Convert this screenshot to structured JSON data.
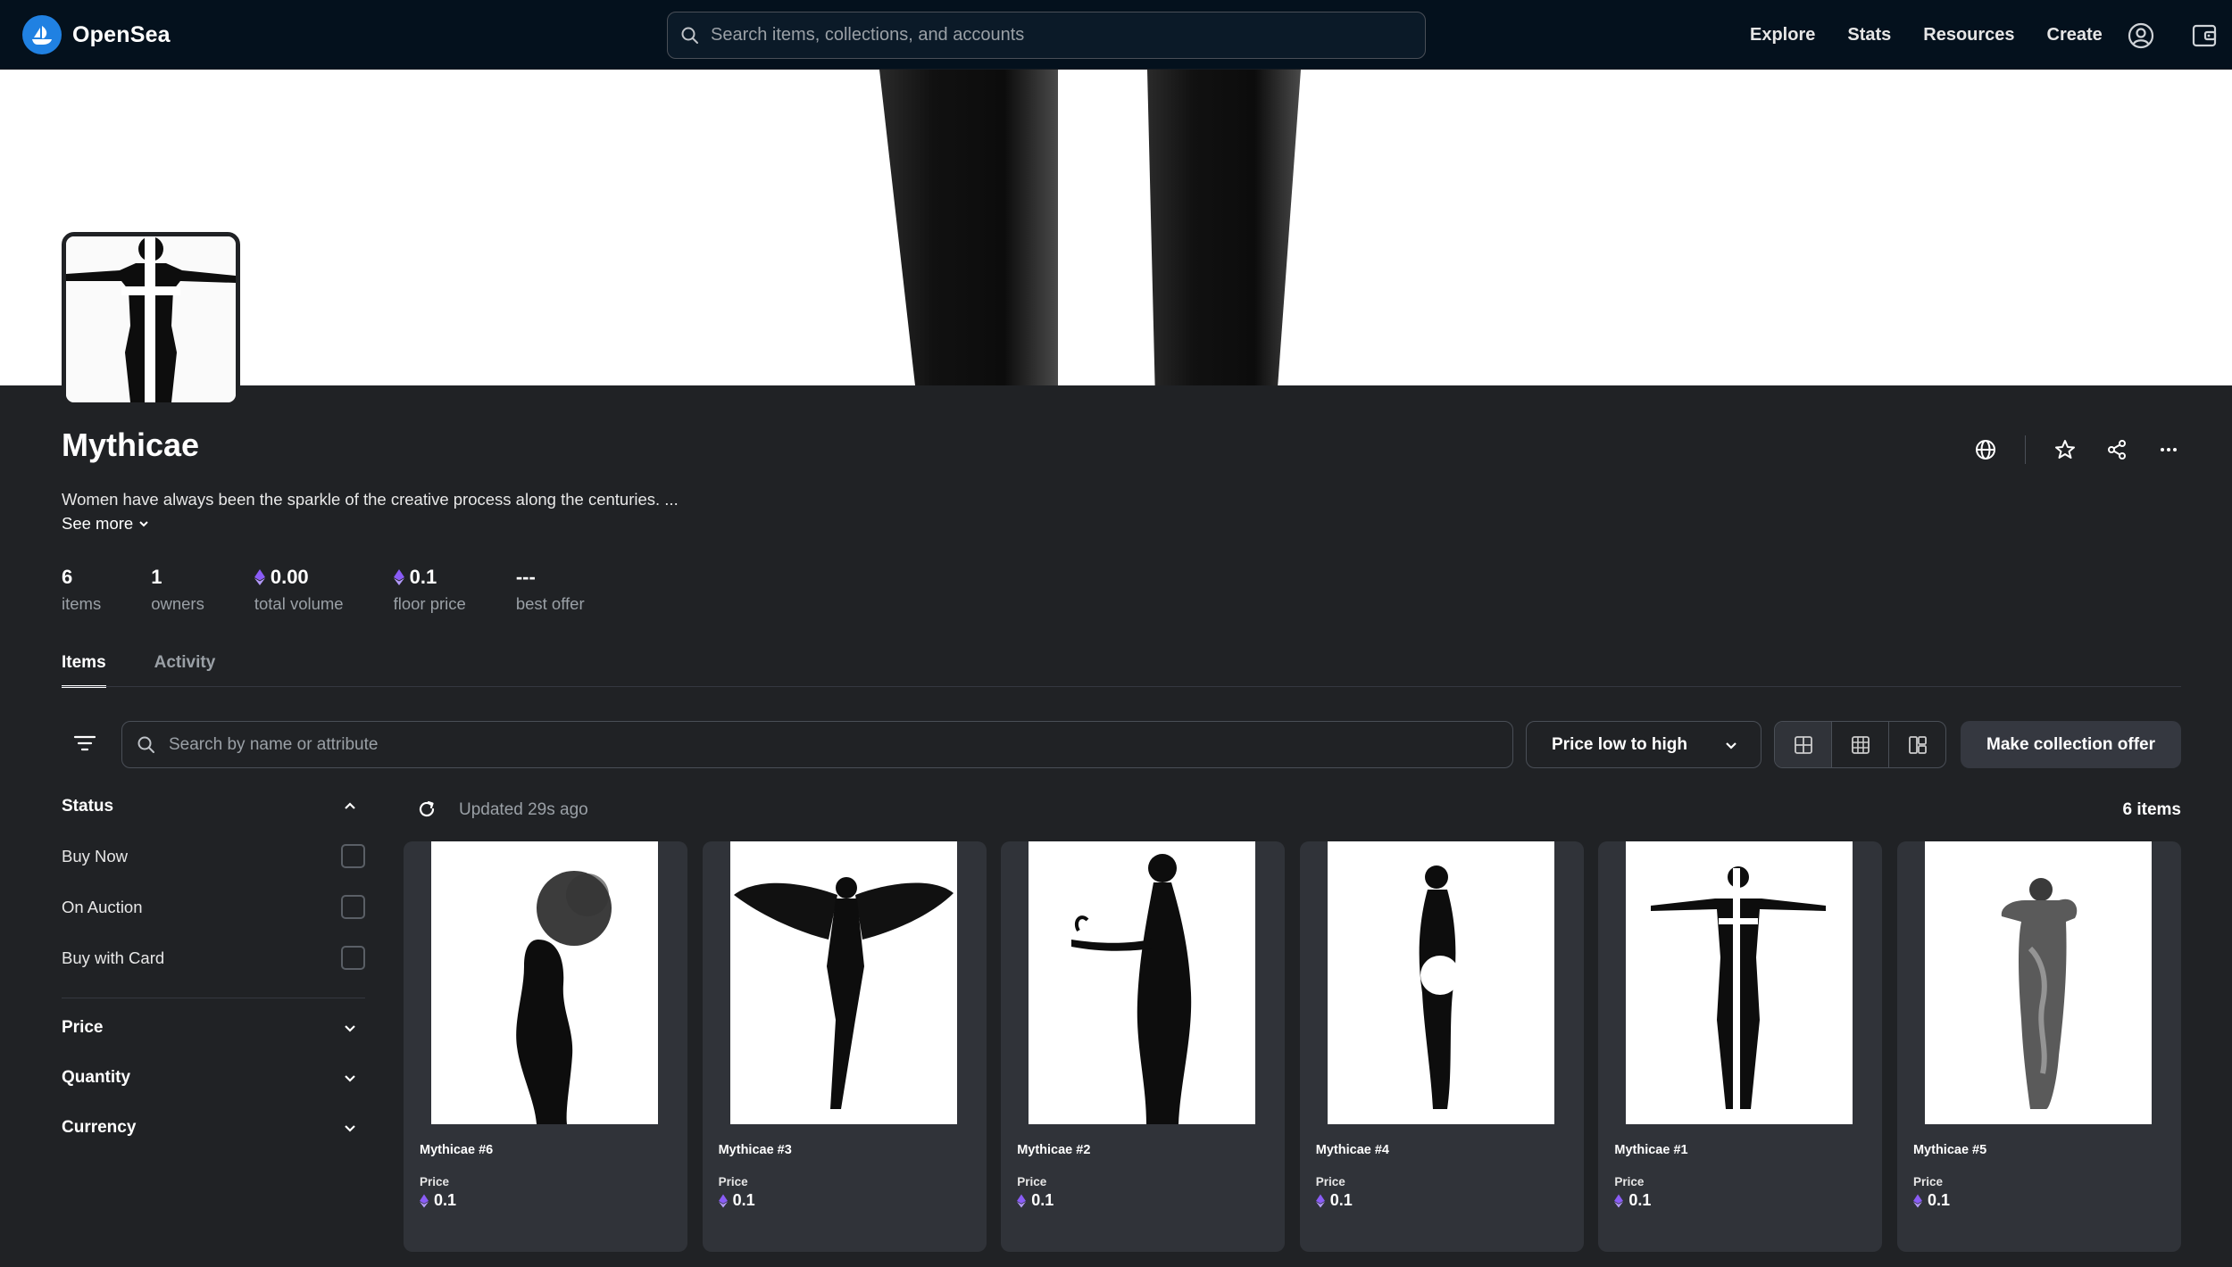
{
  "nav": {
    "brand": "OpenSea",
    "search_placeholder": "Search items, collections, and accounts",
    "links": [
      "Explore",
      "Stats",
      "Resources",
      "Create"
    ]
  },
  "collection": {
    "title": "Mythicae",
    "description": "Women have always been the sparkle of the creative process along the centuries.  ...",
    "see_more": "See more",
    "stats": [
      {
        "value": "6",
        "label": "items",
        "eth": false
      },
      {
        "value": "1",
        "label": "owners",
        "eth": false
      },
      {
        "value": "0.00",
        "label": "total volume",
        "eth": true
      },
      {
        "value": "0.1",
        "label": "floor price",
        "eth": true
      },
      {
        "value": "---",
        "label": "best offer",
        "eth": false
      }
    ]
  },
  "tabs": [
    "Items",
    "Activity"
  ],
  "toolbar": {
    "search_placeholder": "Search by name or attribute",
    "sort_label": "Price low to high",
    "offer_label": "Make collection offer"
  },
  "sidebar": {
    "status_label": "Status",
    "status_options": [
      "Buy Now",
      "On Auction",
      "Buy with Card"
    ],
    "price_label": "Price",
    "quantity_label": "Quantity",
    "currency_label": "Currency"
  },
  "results": {
    "updated": "Updated 29s ago",
    "count": "6 items",
    "price_label": "Price",
    "items": [
      {
        "name": "Mythicae #6",
        "price": "0.1"
      },
      {
        "name": "Mythicae #3",
        "price": "0.1"
      },
      {
        "name": "Mythicae #2",
        "price": "0.1"
      },
      {
        "name": "Mythicae #4",
        "price": "0.1"
      },
      {
        "name": "Mythicae #1",
        "price": "0.1"
      },
      {
        "name": "Mythicae #5",
        "price": "0.1"
      }
    ]
  },
  "colors": {
    "nav_bg": "#04111d",
    "page_bg": "#202225",
    "card_bg": "#303339",
    "eth": "#8a5cf6"
  }
}
